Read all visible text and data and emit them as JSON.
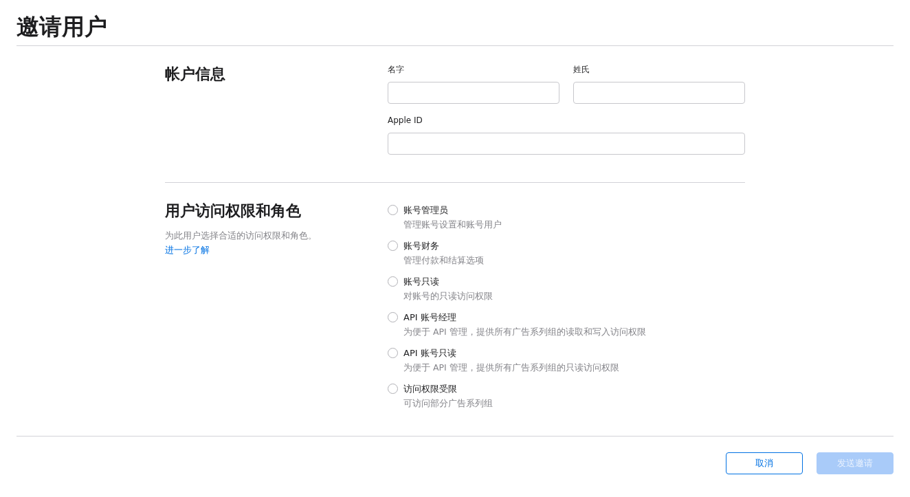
{
  "page_title": "邀请用户",
  "account_section": {
    "heading": "帐户信息",
    "fields": [
      {
        "label": "名字"
      },
      {
        "label": "姓氏"
      },
      {
        "label": "Apple ID"
      }
    ]
  },
  "role_section": {
    "heading": "用户访问权限和角色",
    "description": "为此用户选择合适的访问权限和角色。",
    "link": "进一步了解",
    "roles": [
      {
        "name": "账号管理员",
        "description": "管理账号设置和账号用户",
        "selected": false
      },
      {
        "name": "账号财务",
        "description": "管理付款和结算选项",
        "selected": false
      },
      {
        "name": "账号只读",
        "description": "对账号的只读访问权限",
        "selected": false
      },
      {
        "name": "API 账号经理",
        "description": "为便于 API 管理，提供所有广告系列组的读取和写入访问权限",
        "selected": false
      },
      {
        "name": "API 账号只读",
        "description": "为便于 API 管理，提供所有广告系列组的只读访问权限",
        "selected": false
      },
      {
        "name": "访问权限受限",
        "description": "可访问部分广告系列组",
        "selected": false
      }
    ]
  },
  "buttons": {
    "cancel": {
      "label": "取消"
    },
    "submit": {
      "label": "发送邀请",
      "disabled": true
    }
  }
}
